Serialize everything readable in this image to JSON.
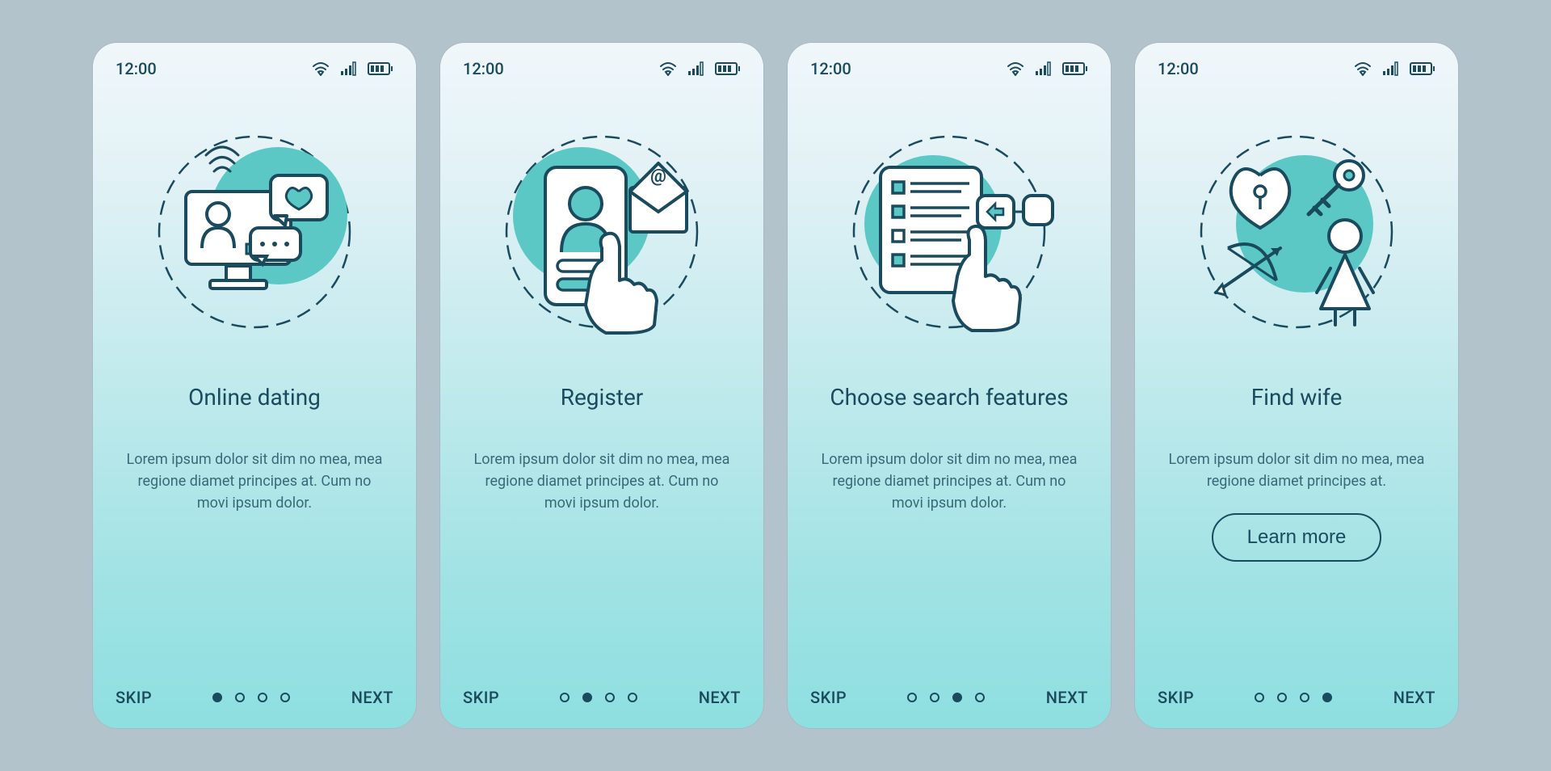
{
  "status": {
    "time": "12:00"
  },
  "icons": {
    "wifi": "wifi-icon",
    "signal": "signal-icon",
    "battery": "battery-icon"
  },
  "buttons": {
    "skip": "SKIP",
    "next": "NEXT",
    "learn_more": "Learn more"
  },
  "colors": {
    "navy": "#1a4a5e",
    "teal": "#5fc8d3",
    "accent": "#5bc8c5",
    "bg": "#b2c3cc"
  },
  "screens": [
    {
      "title": "Online dating",
      "body": "Lorem ipsum dolor sit dim no mea, mea regione diamet principes at. Cum no movi ipsum dolor.",
      "active_dot": 0,
      "has_learn_more": false,
      "illustration": "online-dating"
    },
    {
      "title": "Register",
      "body": "Lorem ipsum dolor sit dim no mea, mea regione diamet principes at. Cum no movi ipsum dolor.",
      "active_dot": 1,
      "has_learn_more": false,
      "illustration": "register"
    },
    {
      "title": "Choose search features",
      "body": "Lorem ipsum dolor sit dim no mea, mea regione diamet principes at. Cum no movi ipsum dolor.",
      "active_dot": 2,
      "has_learn_more": false,
      "illustration": "search-features"
    },
    {
      "title": "Find wife",
      "body": "Lorem ipsum dolor sit dim no mea, mea regione diamet principes at.",
      "active_dot": 3,
      "has_learn_more": true,
      "illustration": "find-wife"
    }
  ]
}
